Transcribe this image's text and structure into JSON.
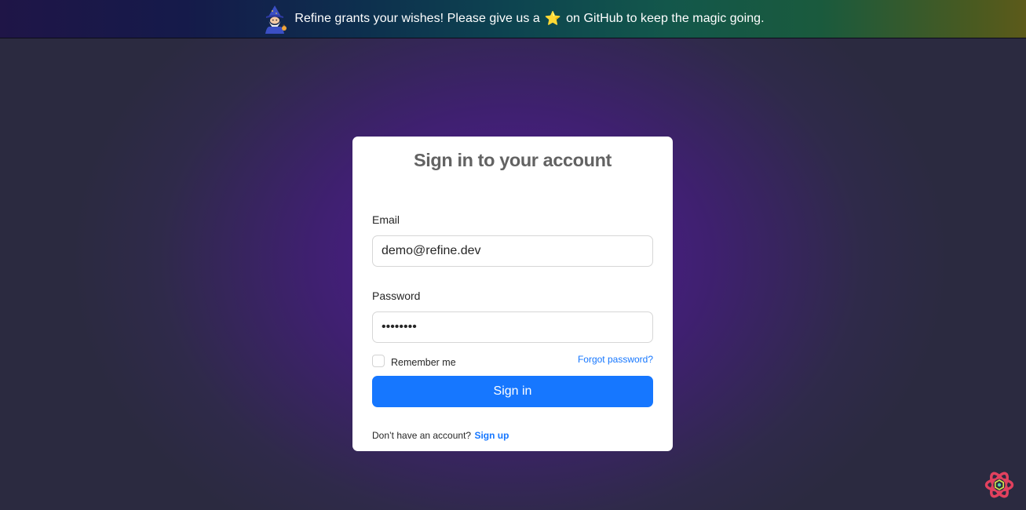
{
  "banner": {
    "text_before": "Refine grants your wishes! Please give us a",
    "star_icon": "star-icon",
    "text_after": "on GitHub to keep the magic going.",
    "mascot_icon": "wizard-mascot-icon"
  },
  "login": {
    "title": "Sign in to your account",
    "email": {
      "label": "Email",
      "value": "demo@refine.dev"
    },
    "password": {
      "label": "Password",
      "value": "demodemo"
    },
    "remember_label": "Remember me",
    "forgot_label": "Forgot password?",
    "submit_label": "Sign in",
    "signup_prompt": "Don’t have an account?",
    "signup_label": "Sign up"
  },
  "devtools": {
    "icon": "refine-devtools-icon"
  },
  "colors": {
    "accent": "#1677ff",
    "title": "#626262",
    "star": "#f6c443"
  }
}
